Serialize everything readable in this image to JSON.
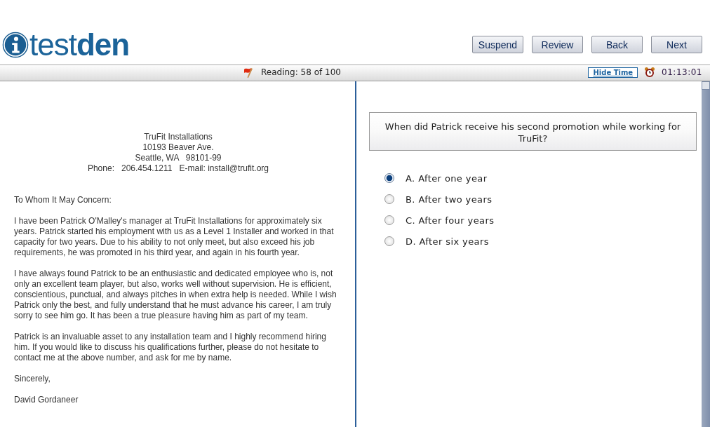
{
  "logo": {
    "text": "test**den**"
  },
  "buttons": [
    {
      "label": "Suspend"
    },
    {
      "label": "Review"
    },
    {
      "label": "Back"
    },
    {
      "label": "Next"
    }
  ],
  "status_bar": {
    "section": "Reading: 58 of 100",
    "flagged": true,
    "hide_time": "Hide Time",
    "timer": "01:13:01"
  },
  "passage": {
    "letterhead": [
      "TruFit Installations",
      "10193 Beaver Ave.",
      "Seattle, WA   98101-99",
      "Phone:   206.454.1211   E-mail: install@trufit.org"
    ],
    "paragraphs": [
      "To Whom It May Concern:",
      "I have been Patrick O'Malley's manager at TruFit Installations for approximately six years. Patrick started his employment with us as a Level 1 Installer and worked in that capacity for two years. Due to his ability to not only meet, but also exceed his job requirements, he was promoted in his third year, and again in his fourth year.",
      "I have always found Patrick to be an enthusiastic and dedicated employee who is, not only an excellent team player, but also, works well without supervision. He is efficient, conscientious, punctual, and always pitches in when extra help is needed. While I wish Patrick only the best, and fully understand that he must advance his career, I am truly sorry to see him go. It has been a true pleasure having him as part of my team.",
      "Patrick is an invaluable asset to any installation team and I highly recommend hiring him. If you would like to discuss his qualifications further, please do not hesitate to contact me at the above number, and ask for me by name.",
      "Sincerely,",
      "David Gordaneer"
    ]
  },
  "question": {
    "prompt": "When did Patrick receive his second promotion while working for TruFit?",
    "options": [
      {
        "label": "A. After one year",
        "selected": true
      },
      {
        "label": "B. After two years",
        "selected": false
      },
      {
        "label": "C. After four years",
        "selected": false
      },
      {
        "label": "D. After six years",
        "selected": false
      }
    ]
  }
}
